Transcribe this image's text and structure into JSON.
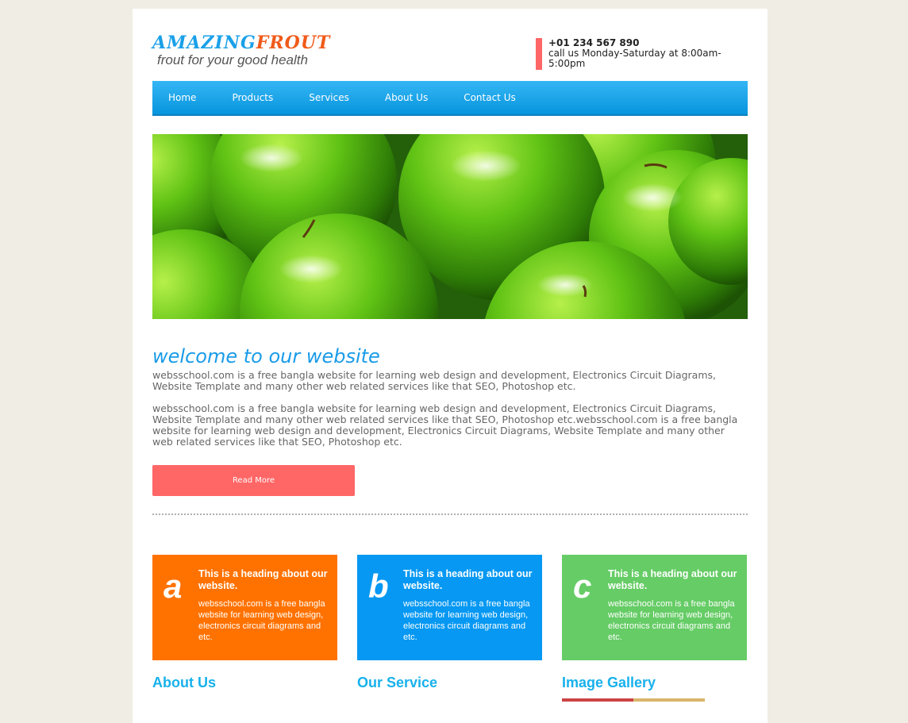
{
  "header": {
    "logo_part1": "AMAZING",
    "logo_part2": "FROUT",
    "tagline": "frout for your good health",
    "phone": "+01 234 567 890",
    "hours": "call us Monday-Saturday at 8:00am-5:00pm"
  },
  "nav": {
    "items": [
      "Home",
      "Products",
      "Services",
      "About Us",
      "Contact Us"
    ]
  },
  "welcome": {
    "title": "welcome to our website",
    "para1": "websschool.com is a free bangla website for learning web design and development, Electronics Circuit Diagrams, Website Template and many other web related services like that SEO, Photoshop etc.",
    "para2": "websschool.com is a free bangla website for learning web design and development, Electronics Circuit Diagrams, Website Template and many other web related services like that SEO, Photoshop etc.websschool.com is a free bangla website for learning web design and development, Electronics Circuit Diagrams, Website Template and many other web related services like that SEO, Photoshop etc.",
    "button": "Read More"
  },
  "features": [
    {
      "letter": "a",
      "heading": "This is a heading about our website.",
      "text": "websschool.com is a free bangla website for learning web design, electronics circuit diagrams and etc.",
      "color": "#ff7200"
    },
    {
      "letter": "b",
      "heading": "This is a heading about our website.",
      "text": "websschool.com is a free bangla website for learning web design, electronics circuit diagrams and etc.",
      "color": "#0698f2"
    },
    {
      "letter": "c",
      "heading": "This is a heading about our website.",
      "text": "websschool.com is a free bangla website for learning web design, electronics circuit diagrams and etc.",
      "color": "#66cc66"
    }
  ],
  "bottom": {
    "about": "About Us",
    "service": "Our Service",
    "gallery": "Image Gallery"
  },
  "colors": {
    "accent_blue": "#1a9be8",
    "button_red": "#ff6666",
    "page_bg": "#f0ede4"
  }
}
